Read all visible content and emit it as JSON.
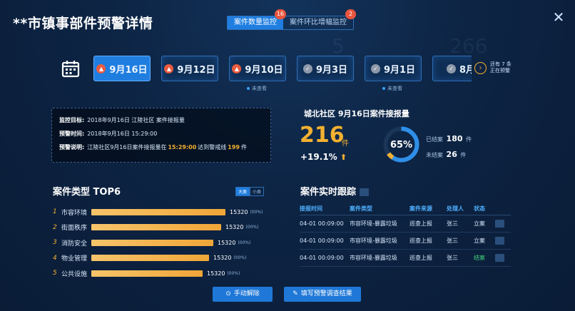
{
  "header": {
    "title": "**市镇事部件预警详情",
    "close_icon": "close-icon"
  },
  "mode_toggle": {
    "tabs": [
      {
        "label": "案件数量监控",
        "badge": "16",
        "active": true
      },
      {
        "label": "案件环比增幅监控",
        "badge": "2",
        "active": false
      }
    ]
  },
  "date_tabs": {
    "calendar_icon": "calendar-icon",
    "items": [
      {
        "label": "9月16日",
        "icon": "alarm-icon",
        "active": true,
        "unseen": ""
      },
      {
        "label": "9月12日",
        "icon": "alarm-icon",
        "active": false,
        "unseen": ""
      },
      {
        "label": "9月10日",
        "icon": "alarm-icon",
        "active": false,
        "unseen": "未查看"
      },
      {
        "label": "9月3日",
        "icon": "check-icon",
        "active": false,
        "unseen": ""
      },
      {
        "label": "9月1日",
        "icon": "check-icon",
        "active": false,
        "unseen": "未查看"
      },
      {
        "label": "8月",
        "icon": "check-icon",
        "active": false,
        "unseen": ""
      }
    ],
    "more_label_line1": "还有 7 条",
    "more_label_line2": "正在预警"
  },
  "info": {
    "target_key": "监控目标:",
    "target_value": "2018年9月16日 江陵社区 案件接报量",
    "time_key": "预警时间:",
    "time_value": "2018年9月16日 15:29:00",
    "desc_key": "预警说明:",
    "desc_prefix": "江陵社区9月16日案件接报量在",
    "desc_time": "15:29:00",
    "desc_mid": "达到警戒线",
    "desc_threshold": "199",
    "desc_suffix": "件"
  },
  "stats": {
    "title": "城北社区 9月16日案件接报量",
    "count": "216",
    "count_unit": "件",
    "growth": "+19.1%",
    "percent": "65%",
    "percent_value": 0.65,
    "closed_label": "已结案",
    "closed_value": "180",
    "open_label": "未结案",
    "open_value": "26",
    "unit": "件",
    "colors": {
      "ring": "#2f8fe8",
      "ring_accent": "#f4b030",
      "track": "#1a3558"
    }
  },
  "top6": {
    "title": "案件类型 TOP6",
    "toggle_large": "大类",
    "toggle_small": "小类",
    "items": [
      {
        "idx": "1",
        "name": "市容环境",
        "value": "15320",
        "pct": "(00%)",
        "level": 1.0
      },
      {
        "idx": "2",
        "name": "街面秩序",
        "value": "15320",
        "pct": "(00%)",
        "level": 0.97
      },
      {
        "idx": "3",
        "name": "消防安全",
        "value": "15320",
        "pct": "(00%)",
        "level": 0.91
      },
      {
        "idx": "4",
        "name": "物业管理",
        "value": "15320",
        "pct": "(00%)",
        "level": 0.88
      },
      {
        "idx": "5",
        "name": "公共设施",
        "value": "15320",
        "pct": "(00%)",
        "level": 0.83
      }
    ]
  },
  "tracking": {
    "title": "案件实时跟踪",
    "headers": [
      "接报时间",
      "案件类型",
      "案件来源",
      "处理人",
      "状态"
    ],
    "rows": [
      {
        "time": "04-01 00:09:00",
        "type": "市容环境-暴露垃圾",
        "source": "巡查上报",
        "handler": "张三",
        "status": "立案",
        "closed": false
      },
      {
        "time": "04-01 00:09:00",
        "type": "市容环境-暴露垃圾",
        "source": "巡查上报",
        "handler": "张三",
        "status": "立案",
        "closed": false
      },
      {
        "time": "04-01 00:09:00",
        "type": "市容环境-暴露垃圾",
        "source": "巡查上报",
        "handler": "张三",
        "status": "结案",
        "closed": true
      }
    ]
  },
  "actions": {
    "manual_release": "手动解除",
    "fill_result": "填写预警调查结果"
  }
}
